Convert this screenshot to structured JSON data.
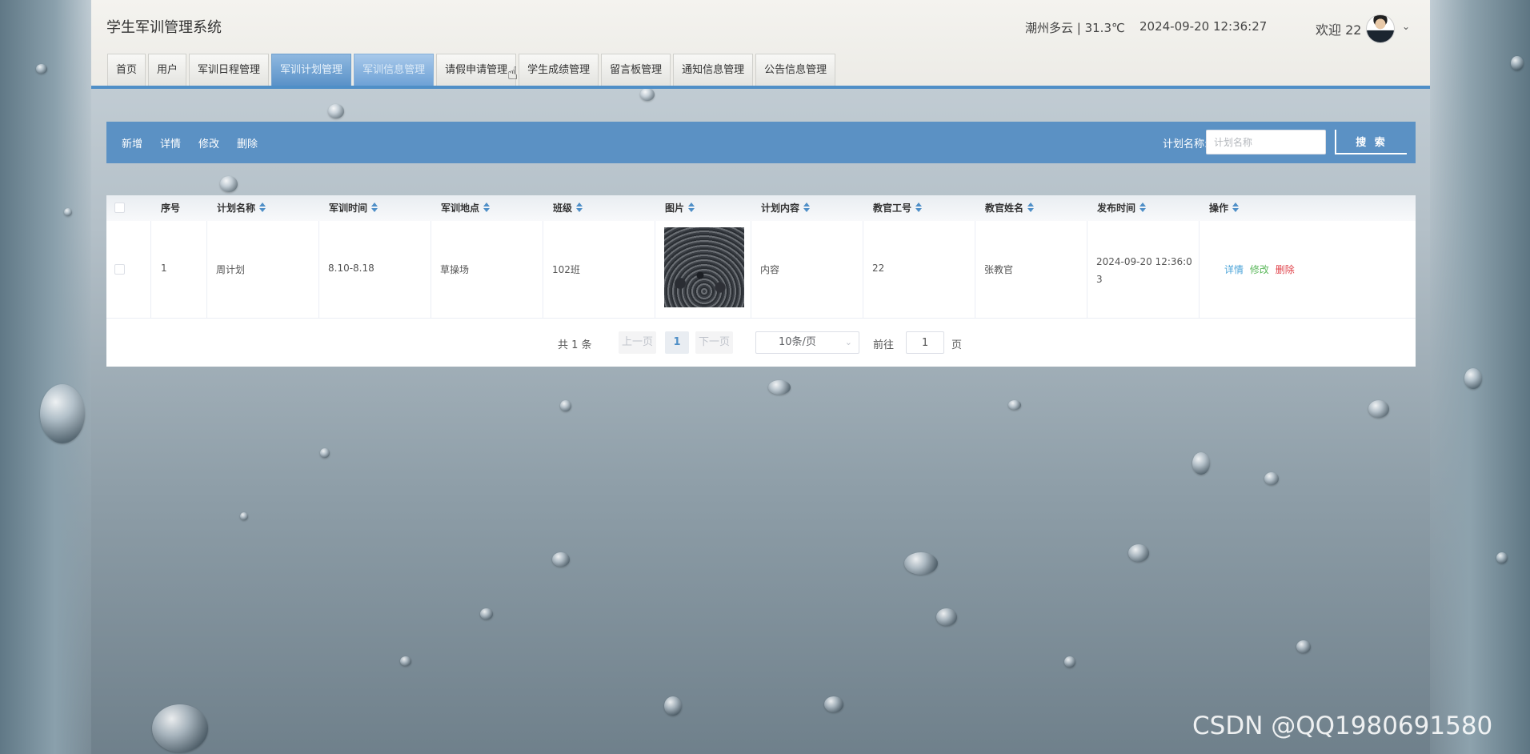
{
  "app": {
    "title": "学生军训管理系统",
    "weather": "潮州多云 | 31.3℃",
    "datetime": "2024-09-20  12:36:27",
    "welcome": "欢迎 22"
  },
  "nav": {
    "items": [
      {
        "label": "首页"
      },
      {
        "label": "用户"
      },
      {
        "label": "军训日程管理"
      },
      {
        "label": "军训计划管理"
      },
      {
        "label": "军训信息管理"
      },
      {
        "label": "请假申请管理"
      },
      {
        "label": "学生成绩管理"
      },
      {
        "label": "留言板管理"
      },
      {
        "label": "通知信息管理"
      },
      {
        "label": "公告信息管理"
      }
    ],
    "active_index": 3,
    "hover_index": 4
  },
  "toolbar": {
    "add": "新增",
    "detail": "详情",
    "edit": "修改",
    "delete": "删除",
    "search_label": "计划名称:",
    "search_placeholder": "计划名称",
    "search_button": "搜 索"
  },
  "table": {
    "columns": [
      "序号",
      "计划名称",
      "军训时间",
      "军训地点",
      "班级",
      "图片",
      "计划内容",
      "教官工号",
      "教官姓名",
      "发布时间",
      "操作"
    ],
    "rows": [
      {
        "index": "1",
        "plan_name": "周计划",
        "time": "8.10-8.18",
        "location": "草操场",
        "class": "102班",
        "content": "内容",
        "instructor_id": "22",
        "instructor_name": "张教官",
        "published": "2024-09-20 12:36:03",
        "ops": {
          "detail": "详情",
          "edit": "修改",
          "delete": "删除"
        }
      }
    ]
  },
  "pagination": {
    "total": "共 1 条",
    "prev": "上一页",
    "current": "1",
    "next": "下一页",
    "page_size": "10条/页",
    "goto_label": "前往",
    "goto_value": "1",
    "page_suffix": "页"
  },
  "watermark": "CSDN @QQ1980691580",
  "colors": {
    "primary": "#5b91c4",
    "nav_active": "#5a92c8",
    "detail": "#4aa3d8",
    "edit": "#5cb85c",
    "delete": "#e0424a"
  }
}
